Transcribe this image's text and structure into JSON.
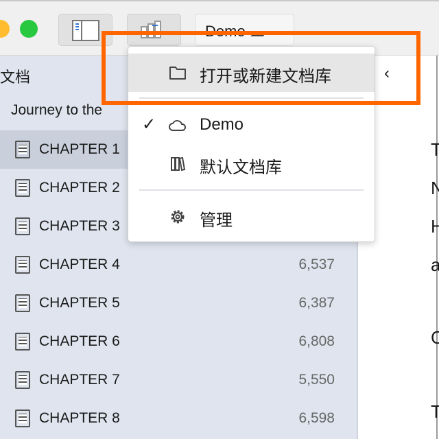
{
  "toolbar": {
    "library_name": "Demo",
    "library_icon": "cloud-icon"
  },
  "sidebar": {
    "header": "文档",
    "project": "Journey to the",
    "items": [
      {
        "name": "CHAPTER 1",
        "count": ""
      },
      {
        "name": "CHAPTER 2",
        "count": ""
      },
      {
        "name": "CHAPTER 3",
        "count": ""
      },
      {
        "name": "CHAPTER 4",
        "count": "6,537"
      },
      {
        "name": "CHAPTER 5",
        "count": "6,387"
      },
      {
        "name": "CHAPTER 6",
        "count": "6,808"
      },
      {
        "name": "CHAPTER 7",
        "count": "5,550"
      },
      {
        "name": "CHAPTER 8",
        "count": "6,598"
      }
    ]
  },
  "content": {
    "nav_back": "‹",
    "lines": [
      "T",
      "N",
      "H",
      "a",
      "C",
      "T"
    ]
  },
  "menu": {
    "items": [
      {
        "label": "打开或新建文档库",
        "icon": "folder-icon"
      },
      {
        "label": "Demo",
        "icon": "cloud-icon",
        "checked": true
      },
      {
        "label": "默认文档库",
        "icon": "books-icon"
      },
      {
        "label": "管理",
        "icon": "gear-icon"
      }
    ]
  },
  "colors": {
    "highlight": "#ff6600",
    "selected_row": "#c9d0dc",
    "sidebar": "#dfe4ee"
  }
}
